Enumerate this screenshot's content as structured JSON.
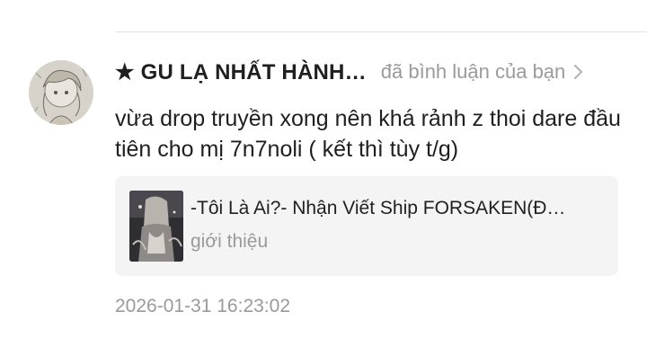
{
  "comment_item": {
    "username": "★ GU LẠ NHẤT HÀNH…",
    "action_text": "đã bình luận của bạn",
    "icons": {
      "avatar": "user-avatar",
      "chevron": "chevron-right-icon",
      "cover": "story-cover-image"
    },
    "comment_text": "vừa drop truyền xong nên khá rảnh z thoi dare đầu tiên cho mị 7n7noli ( kết thì tùy t/g)",
    "story_card": {
      "title": "-Tôi Là Ai?- Nhận Viết Ship FORSAKEN(Đ…",
      "subtitle": "giới thiệu"
    },
    "timestamp": "2026-01-31 16:23:02"
  }
}
